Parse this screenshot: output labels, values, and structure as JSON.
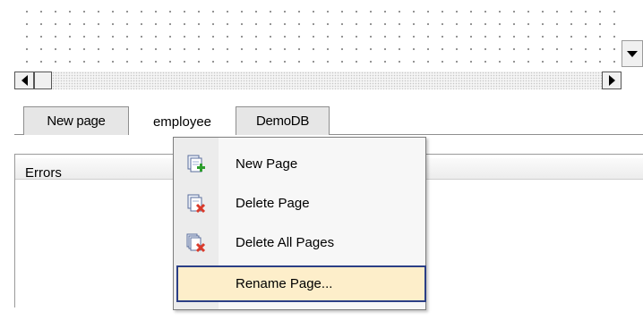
{
  "canvas": {
    "scroll_down_icon": "triangle-down"
  },
  "hscroll": {
    "left_icon": "triangle-left",
    "right_icon": "triangle-right"
  },
  "tabs": [
    {
      "label": "New page",
      "active": false
    },
    {
      "label": "employee",
      "active": true
    },
    {
      "label": "DemoDB",
      "active": false
    }
  ],
  "errors_panel": {
    "header": "Errors"
  },
  "context_menu": {
    "items": [
      {
        "label": "New Page",
        "icon": "new-page-icon"
      },
      {
        "label": "Delete Page",
        "icon": "delete-page-icon"
      },
      {
        "label": "Delete All Pages",
        "icon": "delete-all-pages-icon"
      },
      {
        "label": "Rename Page...",
        "icon": "",
        "selected": true
      }
    ]
  },
  "colors": {
    "selection_bg": "#fdeeca",
    "selection_border": "#2b3f86",
    "add_green": "#2e9e2e",
    "delete_red": "#d93a2b"
  }
}
